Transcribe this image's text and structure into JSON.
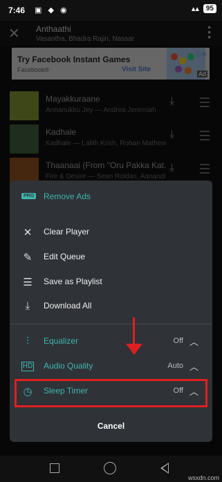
{
  "status_bar": {
    "time": "7:46",
    "battery": "95"
  },
  "now_playing": {
    "title": "Anthaathi",
    "subtitle": "Vasantha, Bhadra Rajin, Nassar"
  },
  "ad": {
    "title": "Try Facebook Instant Games",
    "source": "Facebook®",
    "cta": "Visit Site",
    "badge": "Ad"
  },
  "tracks": [
    {
      "title": "Mayakkuraane",
      "artists": "Annanukku Jey — Andrea Jeremiah",
      "art_color": "#7d8f2e"
    },
    {
      "title": "Kadhale",
      "artists": "Kadhale — Lalith Krish, Rohan Mathew",
      "art_color": "#3d5a3a"
    },
    {
      "title": "Thaanaai (From \"Oru Pakka Kat...",
      "artists": "Fire & Desire — Sean Roldan, Aanandi J...",
      "art_color": "#8a4d1f"
    }
  ],
  "menu": {
    "remove_ads": "Remove Ads",
    "pro_badge": "PRO",
    "clear_player": "Clear Player",
    "edit_queue": "Edit Queue",
    "save_playlist": "Save as Playlist",
    "download_all": "Download All",
    "equalizer": {
      "label": "Equalizer",
      "value": "Off"
    },
    "audio_quality": {
      "label": "Audio Quality",
      "value": "Auto"
    },
    "sleep_timer": {
      "label": "Sleep Timer",
      "value": "Off"
    },
    "cancel": "Cancel"
  },
  "watermark": "wsxdn.com",
  "colors": {
    "accent": "#3fb7ad",
    "highlight": "#e02020",
    "sheet": "#2f3237"
  }
}
